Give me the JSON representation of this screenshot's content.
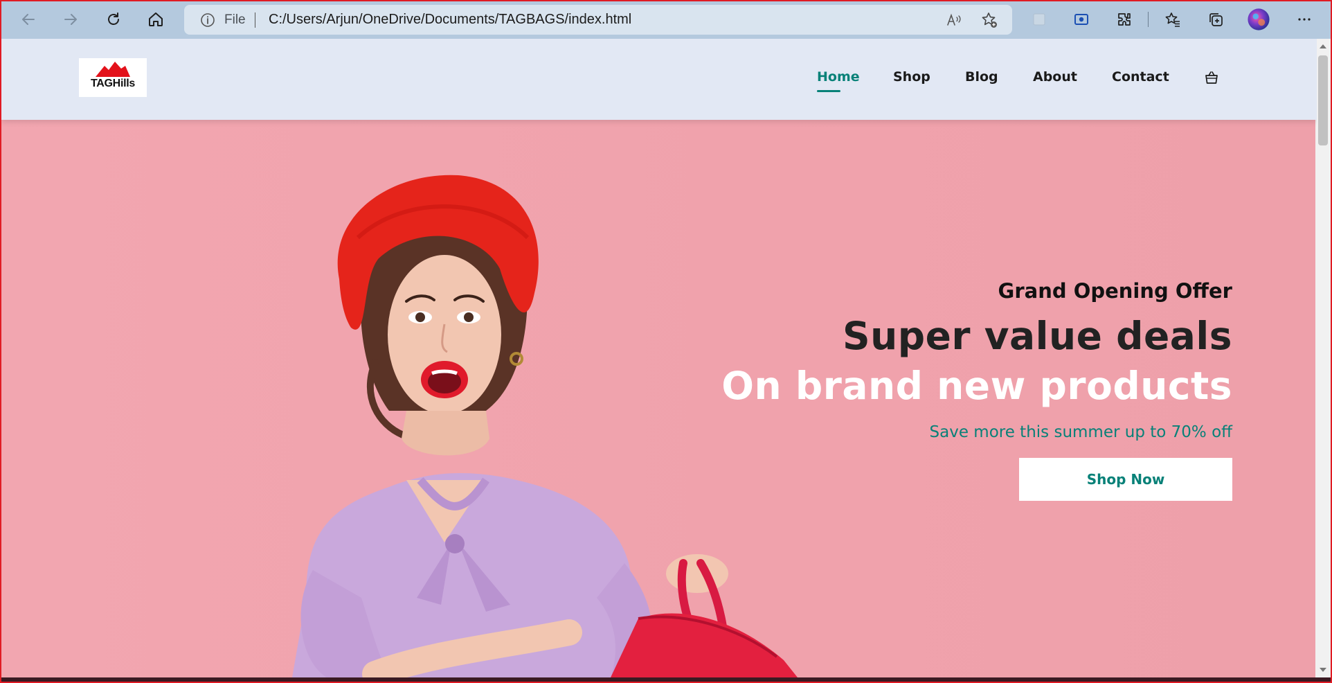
{
  "browser": {
    "nav_buttons": [
      "back-arrow-icon",
      "forward-arrow-icon",
      "refresh-icon",
      "home-icon"
    ],
    "address_bar": {
      "scheme_label": "File",
      "url": "C:/Users/Arjun/OneDrive/Documents/TAGBAGS/index.html"
    },
    "toolbar_icons": [
      "read-aloud-icon",
      "add-favorite-icon",
      "extension-slot-icon",
      "screen-capture-icon",
      "extensions-icon",
      "favorites-icon",
      "collections-icon",
      "profile-avatar-icon",
      "more-options-icon"
    ]
  },
  "site": {
    "logo_text": "TAGHills",
    "nav": {
      "items": [
        {
          "label": "Home",
          "active": true
        },
        {
          "label": "Shop",
          "active": false
        },
        {
          "label": "Blog",
          "active": false
        },
        {
          "label": "About",
          "active": false
        },
        {
          "label": "Contact",
          "active": false
        }
      ],
      "cart_icon": "shopping-bag-icon"
    },
    "hero": {
      "offer": "Grand Opening Offer",
      "headline_1": "Super value deals",
      "headline_2": "On brand new products",
      "subtext": "Save more this summer up to 70% off",
      "cta_label": "Shop Now"
    }
  },
  "colors": {
    "accent": "#088178",
    "hero_bg": "#f0a5ad",
    "header_bg": "#e2e8f4",
    "chrome_bg": "#b4c9de"
  }
}
